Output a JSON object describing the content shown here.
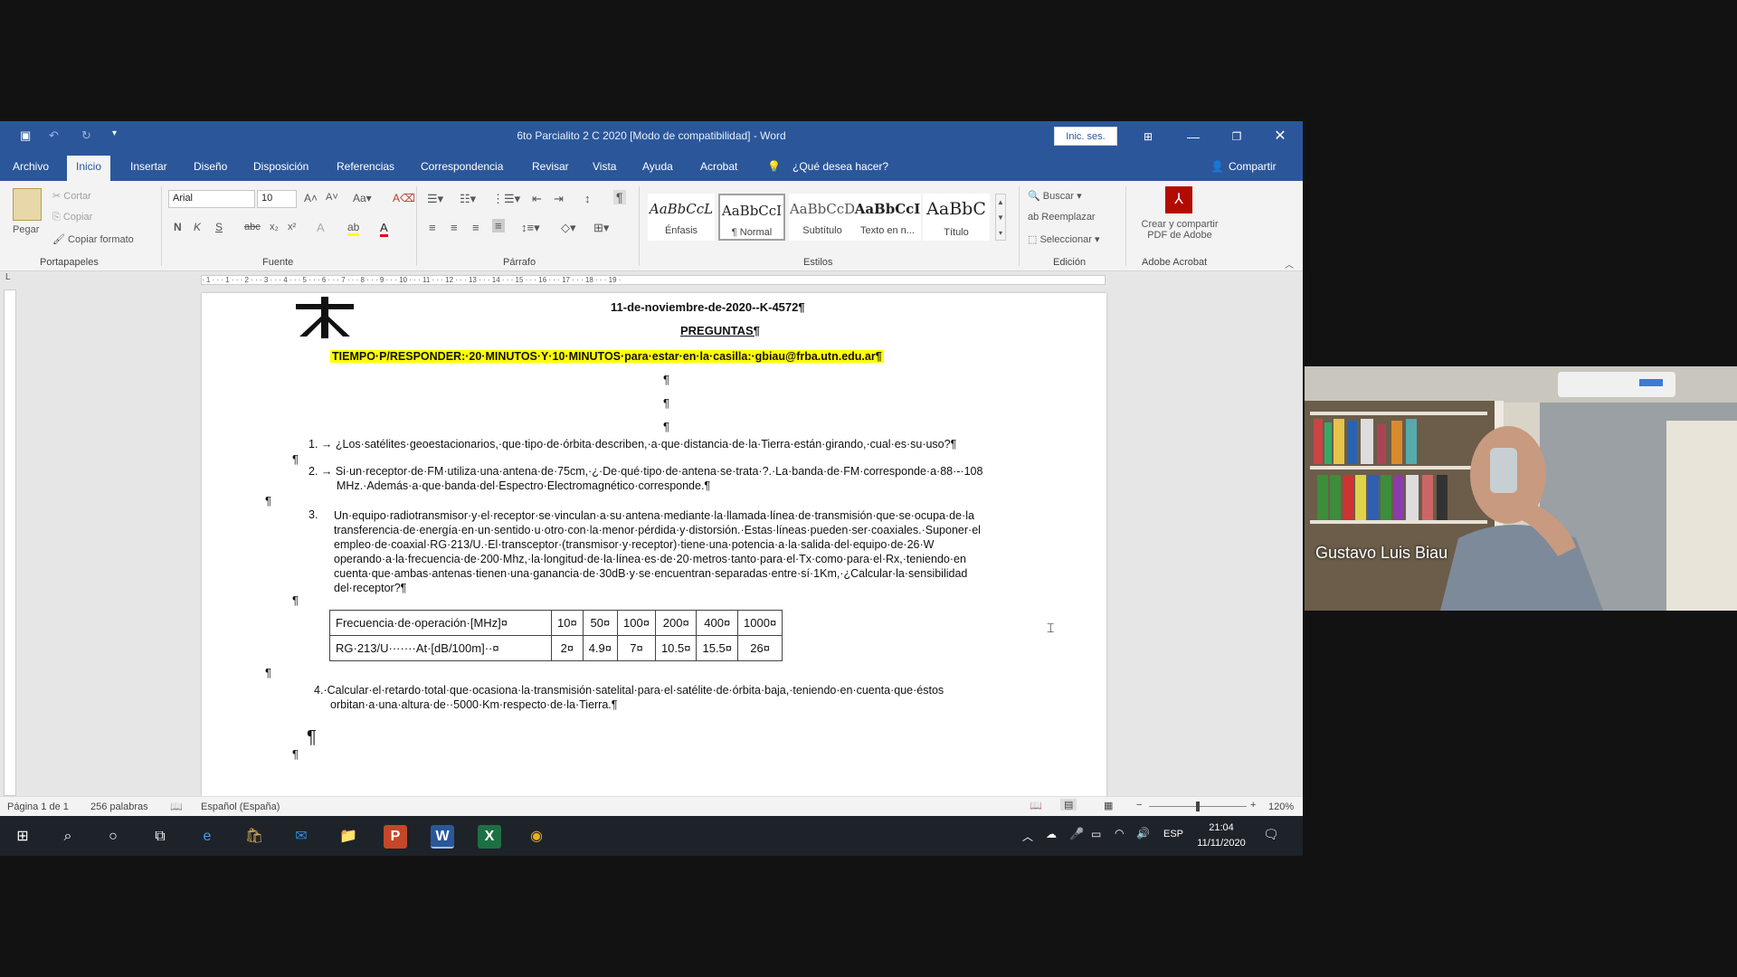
{
  "window": {
    "title": "6to Parcialito  2 C 2020 [Modo de compatibilidad] - Word",
    "signin_label": "Inic. ses."
  },
  "tabs": [
    "Archivo",
    "Inicio",
    "Insertar",
    "Diseño",
    "Disposición",
    "Referencias",
    "Correspondencia",
    "Revisar",
    "Vista",
    "Ayuda",
    "Acrobat"
  ],
  "tell_me": "¿Qué desea hacer?",
  "share_label": "Compartir",
  "ribbon": {
    "clipboard": {
      "paste": "Pegar",
      "cut": "Cortar",
      "copy": "Copiar",
      "format_painter": "Copiar formato",
      "group": "Portapapeles"
    },
    "font": {
      "name": "Arial",
      "size": "10",
      "group": "Fuente"
    },
    "paragraph": {
      "group": "Párrafo"
    },
    "styles": {
      "group": "Estilos",
      "items": [
        {
          "preview": "AaBbCcL",
          "label": "Énfasis"
        },
        {
          "preview": "AaBbCcI",
          "label": "¶ Normal"
        },
        {
          "preview": "AaBbCcD",
          "label": "Subtítulo"
        },
        {
          "preview": "AaBbCcI",
          "label": "Texto en n..."
        },
        {
          "preview": "AaBbC",
          "label": "Título"
        }
      ]
    },
    "editing": {
      "find": "Buscar",
      "replace": "Reemplazar",
      "select": "Seleccionar",
      "group": "Edición"
    },
    "acrobat": {
      "create": "Crear y compartir",
      "create2": "PDF de Adobe",
      "group": "Adobe Acrobat"
    }
  },
  "document": {
    "date": "11-de-noviembre-de-2020--K-4572¶",
    "heading": "PREGUNTAS¶",
    "highlight": "TIEMPO·P/RESPONDER:·20·MINUTOS·Y·10·MINUTOS·para·estar·en·la·casilla:·gbiau@frba.utn.edu.ar¶",
    "pilcrow": "¶",
    "q1": "1. →  ¿Los·satélites·geoestacionarios,·que·tipo·de·órbita·describen,·a·que·distancia·de·la·Tierra·están·girando,·cual·es·su·uso?¶",
    "q2_line1": "2. → Si·un·receptor·de·FM·utiliza·una·antena·de·75cm,·¿·De·qué·tipo·de·antena·se·trata·?.·La·banda·de·FM·corresponde·a·88·-·108",
    "q2_line2": "MHz.·Además·a·que·banda·del·Espectro·Electromagnético·corresponde.¶",
    "q3_num": "3.",
    "q3_lines": [
      "Un·equipo·radiotransmisor·y·el·receptor·se·vinculan·a·su·antena·mediante·la·llamada·línea·de·transmisión·que·se·ocupa·de·la",
      "transferencia·de·energía·en·un·sentido·u·otro·con·la·menor·pérdida·y·distorsión.·Estas·líneas·pueden·ser·coaxiales.·Suponer·el",
      "empleo·de·coaxial·RG·213/U.·El·transceptor·(transmisor·y·receptor)·tiene·una·potencia·a·la·salida·del·equipo·de·26·W",
      "operando·a·la·frecuencia·de·200·Mhz,·la·longitud·de·la·línea·es·de·20·metros·tanto·para·el·Tx·como·para·el·Rx,·teniendo·en",
      "cuenta·que·ambas·antenas·tienen·una·ganancia·de·30dB·y·se·encuentran·separadas·entre·sí·1Km,·¿Calcular·la·sensibilidad",
      "del·receptor?¶"
    ],
    "table": {
      "rows": [
        [
          "Frecuencia·de·operación·[MHz]¤",
          "10¤",
          "50¤",
          "100¤",
          "200¤",
          "400¤",
          "1000¤"
        ],
        [
          "RG·213/U·······At·[dB/100m]··¤",
          "2¤",
          "4.9¤",
          "7¤",
          "10.5¤",
          "15.5¤",
          "26¤"
        ]
      ]
    },
    "q4_line1": "4.·Calcular·el·retardo·total·que·ocasiona·la·transmisión·satelital·para·el·satélite·de·órbita·baja,·teniendo·en·cuenta·que·éstos",
    "q4_line2": "orbitan·a·una·altura·de··5000·Km·respecto·de·la·Tierra.¶"
  },
  "status": {
    "page": "Página 1 de 1",
    "words": "256 palabras",
    "language": "Español (España)",
    "zoom": "120%"
  },
  "taskbar": {
    "lang": "ESP",
    "time": "21:04",
    "date": "11/11/2020"
  },
  "webcam": {
    "name": "Gustavo Luis Biau"
  },
  "colors": {
    "word_blue": "#2b579a",
    "highlight": "#ffff00"
  }
}
